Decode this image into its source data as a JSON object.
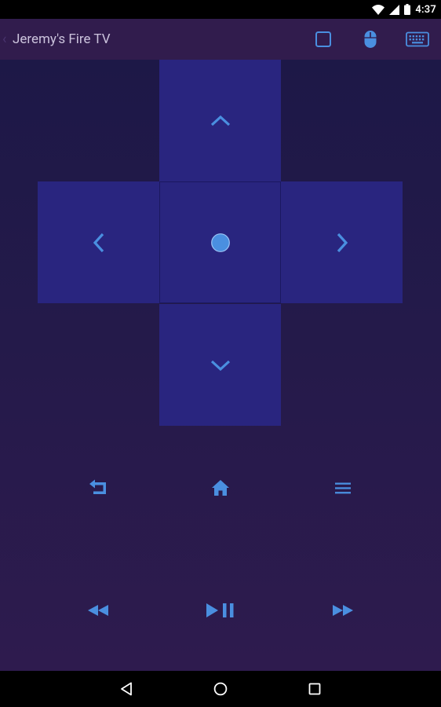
{
  "status_bar": {
    "time": "4:37"
  },
  "app_bar": {
    "title": "Jeremy's Fire TV"
  },
  "colors": {
    "accent": "#4a8fe0",
    "dpad": "#29257f",
    "appbar": "#311c4d",
    "background_top": "#1d1847",
    "background_bottom": "#2e1b4e"
  },
  "icons": {
    "app_bar": [
      "square-icon",
      "mouse-icon",
      "keyboard-icon"
    ],
    "dpad": [
      "chevron-up-icon",
      "chevron-left-icon",
      "select-dot-icon",
      "chevron-right-icon",
      "chevron-down-icon"
    ],
    "controls": [
      "back-return-icon",
      "home-icon",
      "menu-icon",
      "rewind-icon",
      "play-pause-icon",
      "fast-forward-icon"
    ],
    "nav": [
      "nav-back-icon",
      "nav-home-icon",
      "nav-recents-icon"
    ]
  }
}
